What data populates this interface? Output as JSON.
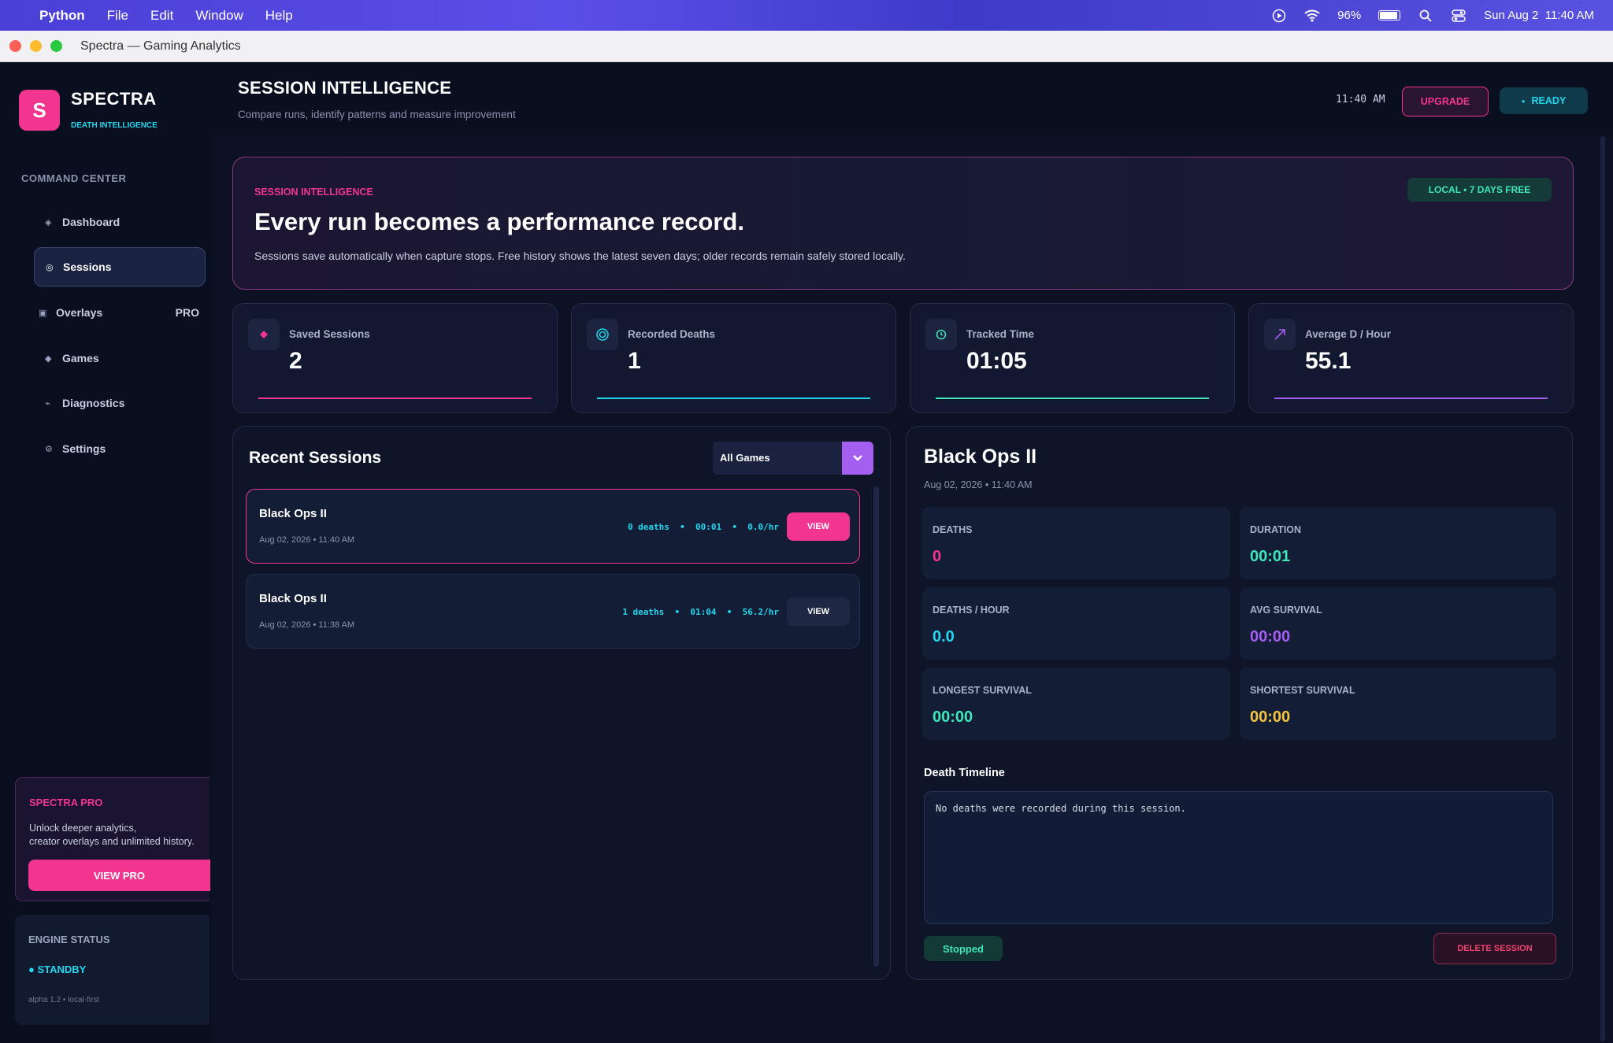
{
  "menubar": {
    "app": "Python",
    "items": [
      "File",
      "Edit",
      "Window",
      "Help"
    ],
    "battery": "96%",
    "datetime": "Sun Aug 2  11:40 AM"
  },
  "window": {
    "title": "Spectra — Gaming Analytics"
  },
  "sidebar": {
    "logo_letter": "S",
    "brand": "SPECTRA",
    "brand_sub": "DEATH INTELLIGENCE",
    "section": "COMMAND CENTER",
    "items": [
      {
        "label": "Dashboard",
        "icon": "◈"
      },
      {
        "label": "Sessions",
        "icon": "◎"
      },
      {
        "label": "Overlays",
        "icon": "▣",
        "tag": "PRO"
      },
      {
        "label": "Games",
        "icon": "◆"
      },
      {
        "label": "Diagnostics",
        "icon": "⌁"
      },
      {
        "label": "Settings",
        "icon": "⚙"
      }
    ],
    "pro": {
      "title": "SPECTRA PRO",
      "text_line1": "Unlock deeper analytics,",
      "text_line2": "creator overlays and unlimited history.",
      "button": "VIEW PRO"
    },
    "engine": {
      "title": "ENGINE STATUS",
      "status": "STANDBY",
      "version": "alpha 1.2 • local-first"
    }
  },
  "header": {
    "title": "SESSION INTELLIGENCE",
    "subtitle": "Compare runs, identify patterns and measure improvement",
    "clock": "11:40 AM",
    "upgrade": "UPGRADE",
    "ready": "READY"
  },
  "hero": {
    "eyebrow": "SESSION INTELLIGENCE",
    "headline": "Every run becomes a performance record.",
    "description": "Sessions save automatically when capture stops. Free history shows the latest seven days; older records remain safely stored locally.",
    "badge": "LOCAL • 7 DAYS FREE"
  },
  "stats": [
    {
      "label": "Saved Sessions",
      "value": "2",
      "icon": "diamond-icon",
      "color": "#f2358f"
    },
    {
      "label": "Recorded Deaths",
      "value": "1",
      "icon": "target-icon",
      "color": "#23d7ee"
    },
    {
      "label": "Tracked Time",
      "value": "01:05",
      "icon": "clock-icon",
      "color": "#3ee6b8"
    },
    {
      "label": "Average D / Hour",
      "value": "55.1",
      "icon": "trend-up-icon",
      "color": "#a45ef0"
    }
  ],
  "recent": {
    "title": "Recent Sessions",
    "filter": "All Games",
    "rows": [
      {
        "game": "Black Ops II",
        "date": "Aug 02, 2026 • 11:40 AM",
        "stats": "0 deaths  •  00:01  •  0.0/hr",
        "button": "VIEW"
      },
      {
        "game": "Black Ops II",
        "date": "Aug 02, 2026 • 11:38 AM",
        "stats": "1 deaths  •  01:04  •  56.2/hr",
        "button": "VIEW"
      }
    ]
  },
  "detail": {
    "title": "Black Ops II",
    "date": "Aug 02, 2026 • 11:40 AM",
    "metrics": [
      {
        "label": "DEATHS",
        "value": "0",
        "color": "#f2358f"
      },
      {
        "label": "DURATION",
        "value": "00:01",
        "color": "#3ee6b8"
      },
      {
        "label": "DEATHS / HOUR",
        "value": "0.0",
        "color": "#23d7ee"
      },
      {
        "label": "AVG SURVIVAL",
        "value": "00:00",
        "color": "#a45ef0"
      },
      {
        "label": "LONGEST SURVIVAL",
        "value": "00:00",
        "color": "#3ee6b8"
      },
      {
        "label": "SHORTEST SURVIVAL",
        "value": "00:00",
        "color": "#f5c542"
      }
    ],
    "timeline_label": "Death Timeline",
    "timeline_text": "No deaths were recorded during this session.",
    "status": "Stopped",
    "delete": "DELETE SESSION"
  }
}
